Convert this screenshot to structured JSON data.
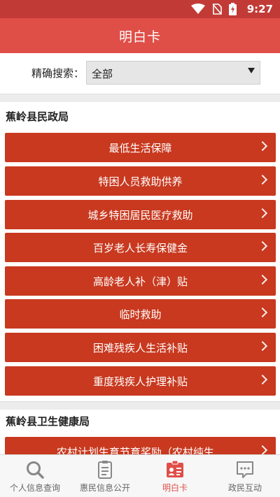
{
  "status_bar": {
    "time": "9:27",
    "icons": [
      "wifi-icon",
      "no-sim-icon",
      "battery-charging-icon"
    ]
  },
  "app_bar": {
    "title": "明白卡"
  },
  "search": {
    "label": "精确搜索：",
    "selected": "全部"
  },
  "sections": [
    {
      "title": "蕉岭县民政局",
      "items": [
        "最低生活保障",
        "特困人员救助供养",
        "城乡特困居民医疗救助",
        "百岁老人长寿保健金",
        "高龄老人补（津）贴",
        "临时救助",
        "困难残疾人生活补贴",
        "重度残疾人护理补贴"
      ]
    },
    {
      "title": "蕉岭县卫生健康局",
      "items": [
        "农村计划生育节育奖励（农村纯生..."
      ]
    }
  ],
  "bottom_nav": [
    {
      "label": "个人信息查询",
      "icon": "search-icon",
      "active": false
    },
    {
      "label": "惠民信息公开",
      "icon": "clipboard-icon",
      "active": false
    },
    {
      "label": "明白卡",
      "icon": "id-card-icon",
      "active": true
    },
    {
      "label": "政民互动",
      "icon": "chat-icon",
      "active": false
    }
  ],
  "colors": {
    "primary": "#e04e48",
    "status_bar": "#c23a36",
    "list_item": "#c8391f"
  }
}
